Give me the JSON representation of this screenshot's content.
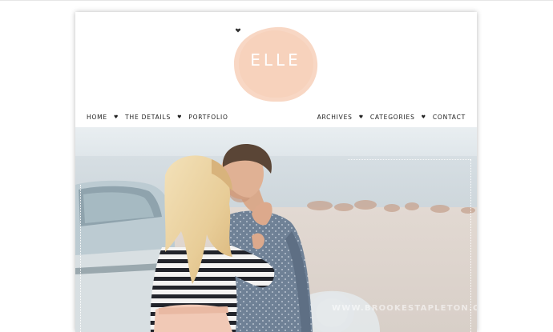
{
  "site": {
    "logo_text": "ELLE",
    "logo_icon": "heart-icon",
    "logo_color": "#f7d2bd"
  },
  "nav": {
    "left": [
      {
        "label": "HOME"
      },
      {
        "label": "THE DETAILS"
      },
      {
        "label": "PORTFOLIO"
      }
    ],
    "right": [
      {
        "label": "ARCHIVES"
      },
      {
        "label": "CATEGORIES"
      },
      {
        "label": "CONTACT"
      }
    ],
    "separator": "♥"
  },
  "hero": {
    "watermark": "WWW.BROOKESTAPLETON.COM"
  }
}
